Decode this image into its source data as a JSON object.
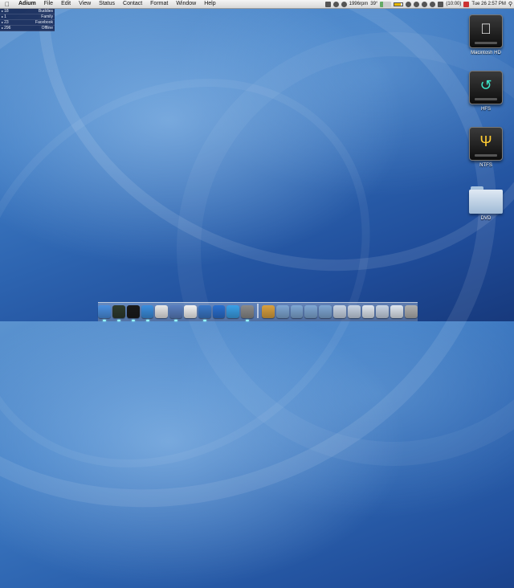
{
  "menubar": {
    "app_name": "Adium",
    "menus": [
      "File",
      "Edit",
      "View",
      "Status",
      "Contact",
      "Format",
      "Window",
      "Help"
    ],
    "fan_speed": "1996rpm",
    "temperature": "39°",
    "battery_time": "(10:00)",
    "clock": "Tue 26 2:57 PM",
    "icons": [
      "adium-status-icon",
      "growl-icon",
      "fan-icon",
      "cpu-meter-icon",
      "battery-icon",
      "bluetooth-icon",
      "timemachine-icon",
      "headphones-icon",
      "wifi-icon",
      "volume-icon",
      "calendar-icon",
      "spotlight-icon"
    ]
  },
  "contact_list": {
    "groups": [
      {
        "count": "18",
        "name": "Buddies"
      },
      {
        "count": "1",
        "name": "Family"
      },
      {
        "count": "23",
        "name": "Facebook"
      },
      {
        "count": "296",
        "name": "Offline"
      }
    ]
  },
  "desktop_icons": [
    {
      "label": "Macintosh HD",
      "icon": "apple-drive-icon"
    },
    {
      "label": "HFS",
      "icon": "timemachine-drive-icon"
    },
    {
      "label": "NTFS",
      "icon": "usb-drive-icon"
    },
    {
      "label": "DVD",
      "icon": "folder-icon"
    }
  ],
  "dock": {
    "apps": [
      {
        "name": "finder-icon",
        "color": "#4a8fe0",
        "running": true
      },
      {
        "name": "activity-monitor-icon",
        "color": "#2e3b2e",
        "running": true
      },
      {
        "name": "terminal-icon",
        "color": "#1a1a1a",
        "running": true
      },
      {
        "name": "safari-icon",
        "color": "#3b8ede",
        "running": true
      },
      {
        "name": "textedit-icon",
        "color": "#e8e8e8",
        "running": false
      },
      {
        "name": "preview-icon",
        "color": "#5a7fbf",
        "running": true
      },
      {
        "name": "ical-icon",
        "color": "#f2f2f2",
        "running": false
      },
      {
        "name": "itunes-icon",
        "color": "#3a78c8",
        "running": true
      },
      {
        "name": "quicktime-icon",
        "color": "#2a6fcf",
        "running": false
      },
      {
        "name": "network-icon",
        "color": "#3aa0e8",
        "running": false
      },
      {
        "name": "system-preferences-icon",
        "color": "#8a8a8a",
        "running": true
      }
    ],
    "stacks": [
      {
        "name": "home-folder-icon",
        "color": "#d8a040"
      },
      {
        "name": "applications-folder-icon",
        "color": "#7fa7d4"
      },
      {
        "name": "documents-folder-icon",
        "color": "#7fa7d4"
      },
      {
        "name": "downloads-folder-icon",
        "color": "#7fa7d4"
      },
      {
        "name": "utilities-folder-icon",
        "color": "#7fa7d4"
      },
      {
        "name": "minimized-window-1-icon",
        "color": "#c8d4e4"
      },
      {
        "name": "minimized-window-2-icon",
        "color": "#c8d4e4"
      },
      {
        "name": "minimized-window-3-icon",
        "color": "#dfe6ef"
      },
      {
        "name": "minimized-window-4-icon",
        "color": "#c8d4e4"
      },
      {
        "name": "minimized-window-5-icon",
        "color": "#dfe6ef"
      },
      {
        "name": "trash-icon",
        "color": "#b0b0b0"
      }
    ]
  }
}
